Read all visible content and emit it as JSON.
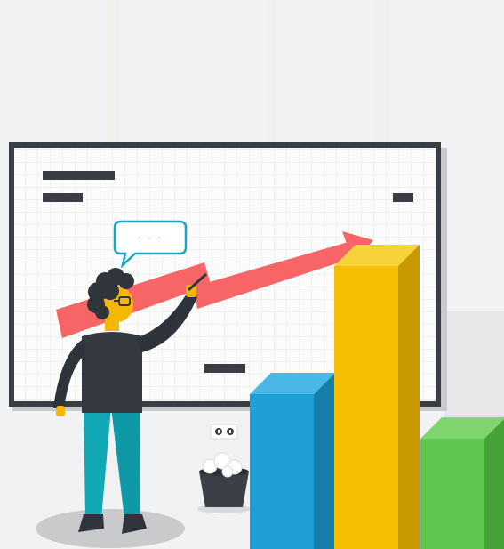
{
  "illustration": {
    "speech_bubble_text": ". . .",
    "colors": {
      "background": "#f1f2f3",
      "board_frame": "#3a3d44",
      "board_fill": "#fbfbfb",
      "grid": "#e7e8ea",
      "arrow": "#f86566",
      "bar_blue": "#1e9fd6",
      "bar_yellow": "#f5be00",
      "bar_green": "#5fc64e",
      "speech_outline": "#16a8bd",
      "person_shirt": "#353941",
      "person_pants": "#12a8b6",
      "person_skin": "#f5b800",
      "person_hair": "#31343b",
      "shadow": "#c9cacc",
      "trash_bin": "#3c3f46"
    },
    "icons": [
      "arrow-up-trend-icon",
      "speech-bubble-icon",
      "power-outlet-icon",
      "trash-bin-icon"
    ]
  }
}
